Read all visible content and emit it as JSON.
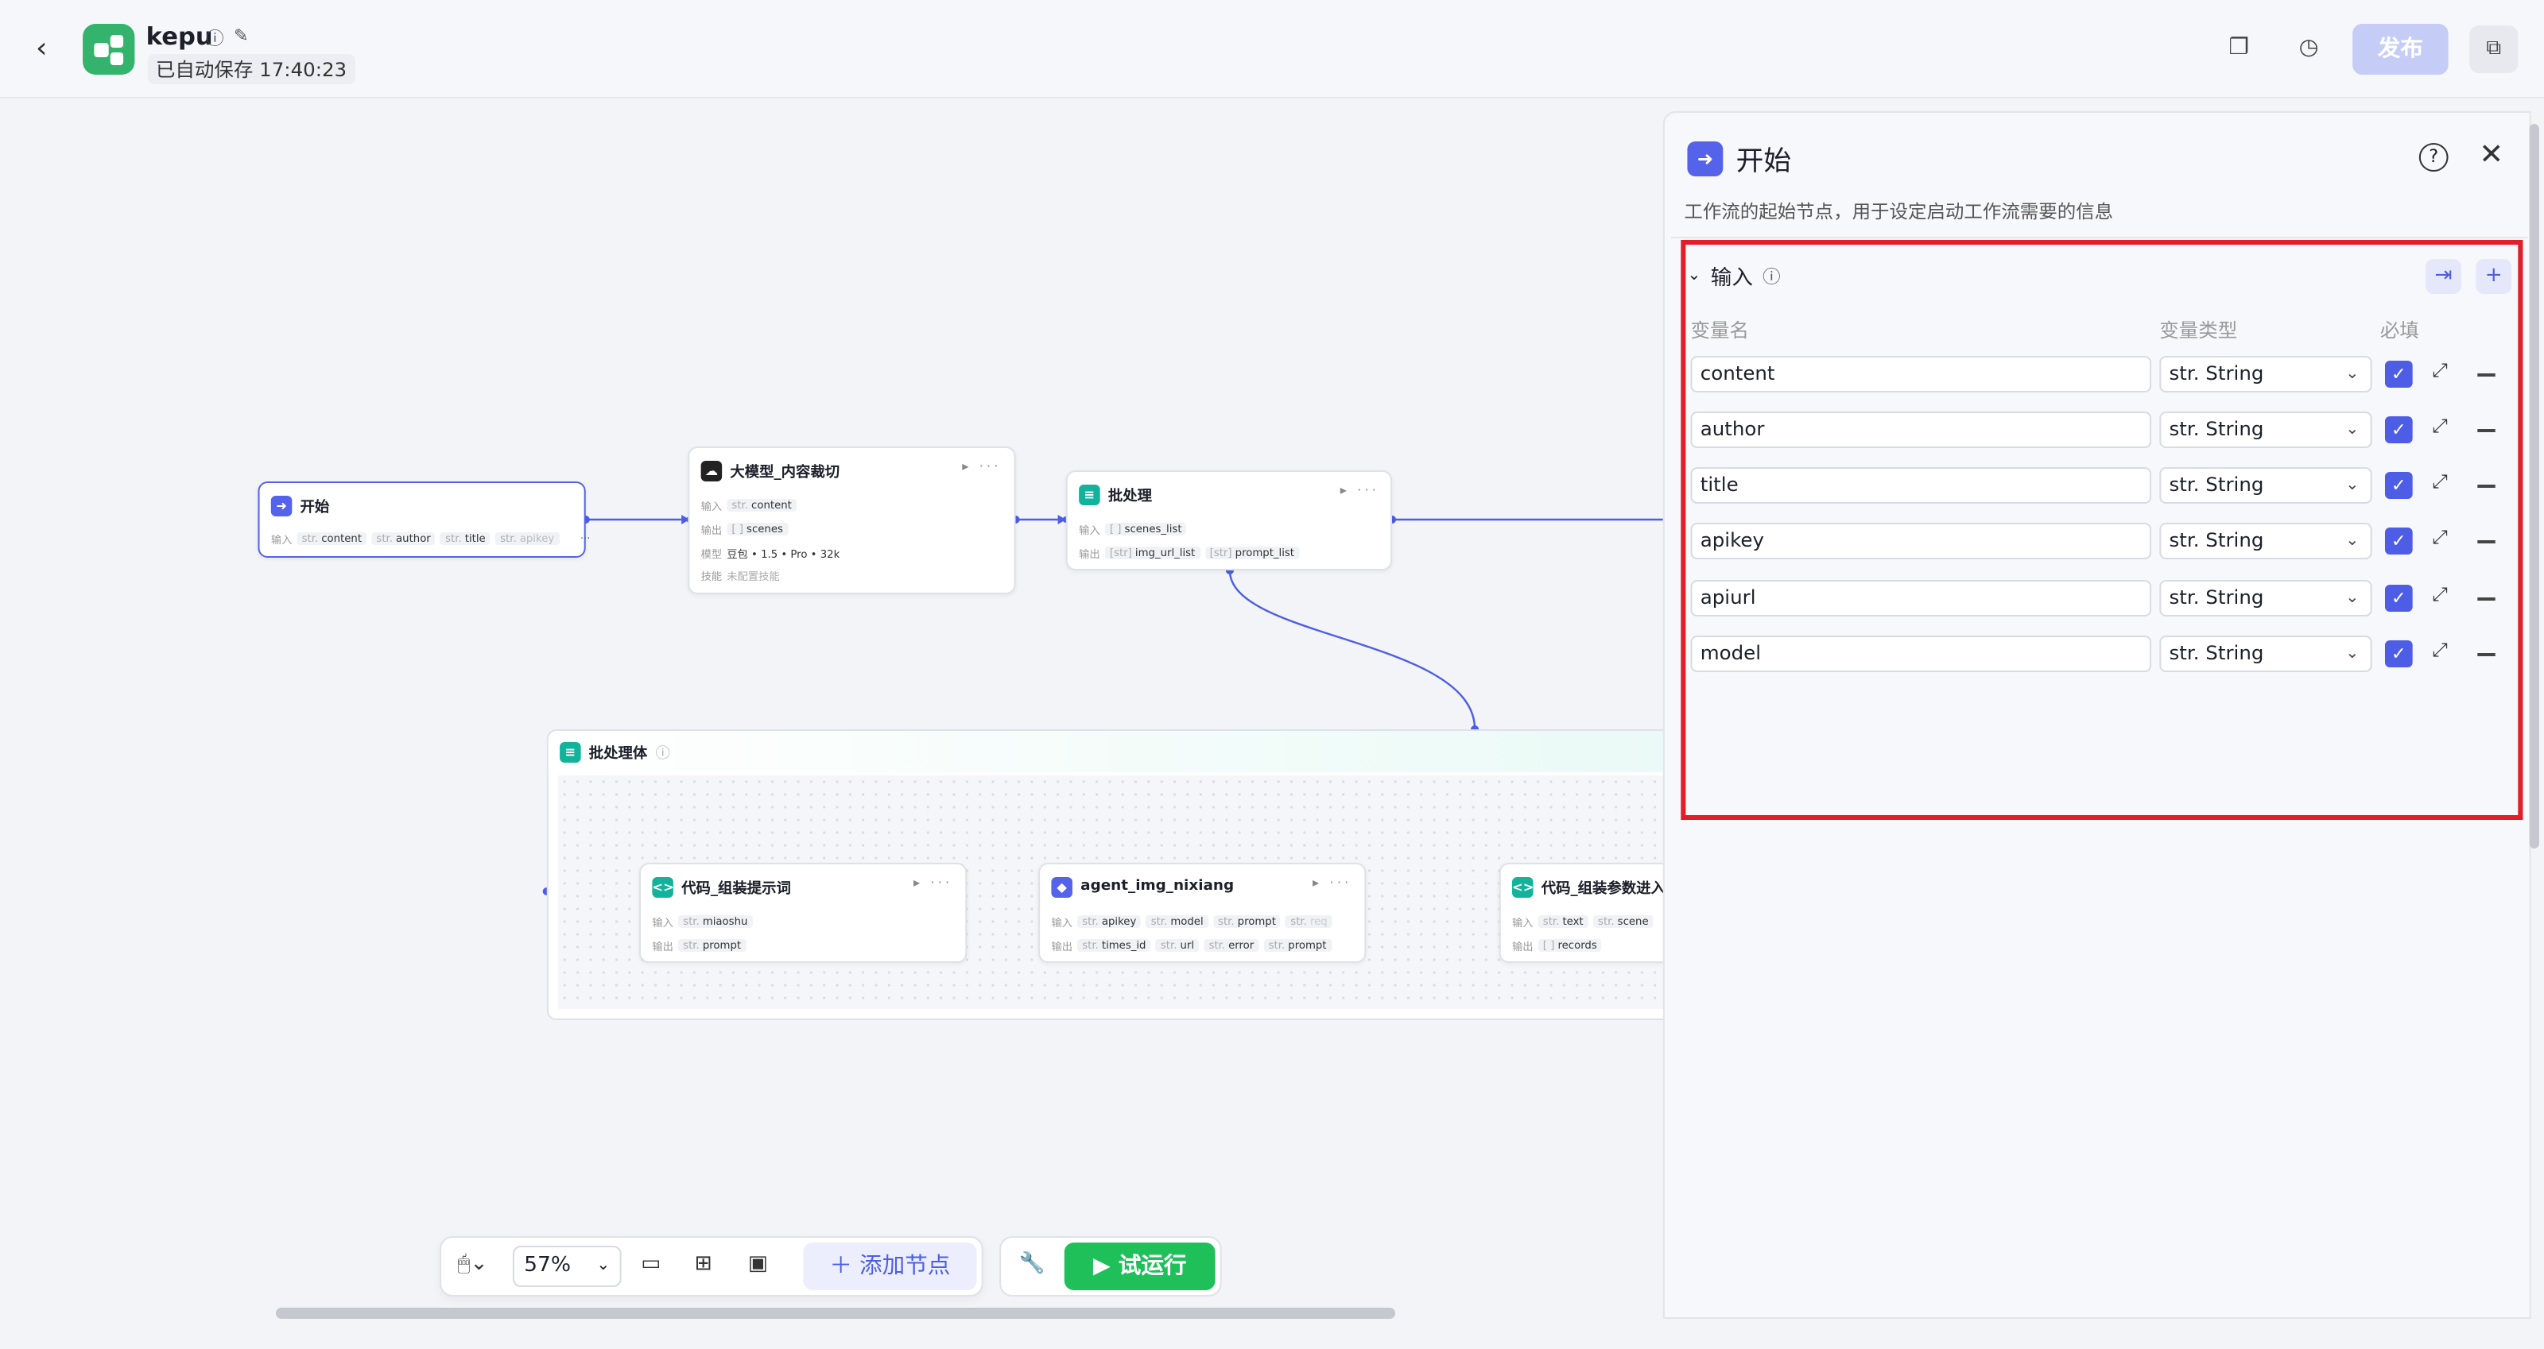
{
  "header": {
    "back_icon": "‹",
    "app_name": "kepu",
    "info_icon": "ⓘ",
    "edit_icon": "✎",
    "autosave": "已自动保存 17:40:23",
    "publish_label": "发布",
    "accent_color": "#5563ea"
  },
  "nodes": {
    "start": {
      "title": "开始",
      "in_label": "输入",
      "params": [
        "content",
        "author",
        "title",
        "apikey"
      ]
    },
    "llm": {
      "title": "大模型_内容裁切",
      "in_label": "输入",
      "out_label": "输出",
      "model_label": "模型",
      "skill_label": "技能",
      "in": "content",
      "out": "scenes",
      "model": "豆包 • 1.5 • Pro • 32k",
      "skill": "未配置技能"
    },
    "batch": {
      "title": "批处理",
      "in_label": "输入",
      "out_label": "输出",
      "in": "scenes_list",
      "out1": "img_url_list",
      "out2": "prompt_list"
    },
    "group": {
      "title": "批处理体"
    },
    "code1": {
      "title": "代码_组装提示词",
      "in_label": "输入",
      "out_label": "输出",
      "in": "miaoshu",
      "out": "prompt"
    },
    "agent": {
      "title": "agent_img_nixiang",
      "in_label": "输入",
      "out_label": "输出",
      "in": [
        "apikey",
        "model",
        "prompt",
        "req"
      ],
      "out": [
        "times_id",
        "url",
        "error",
        "prompt"
      ]
    },
    "code2": {
      "title": "代码_组装参数进入",
      "in_label": "输入",
      "out_label": "输出",
      "in": [
        "text",
        "scene"
      ],
      "out": "records"
    }
  },
  "panel": {
    "title": "开始",
    "description": "工作流的起始节点，用于设定启动工作流需要的信息",
    "section": "输入",
    "col_name": "变量名",
    "col_type": "变量类型",
    "col_required": "必填",
    "variables": [
      {
        "name": "content",
        "type": "str. String"
      },
      {
        "name": "author",
        "type": "str. String"
      },
      {
        "name": "title",
        "type": "str. String"
      },
      {
        "name": "apikey",
        "type": "str. String"
      },
      {
        "name": "apiurl",
        "type": "str. String"
      },
      {
        "name": "model",
        "type": "str. String"
      }
    ]
  },
  "toolbar": {
    "zoom": "57%",
    "add_node": "添加节点",
    "run": "试运行"
  }
}
